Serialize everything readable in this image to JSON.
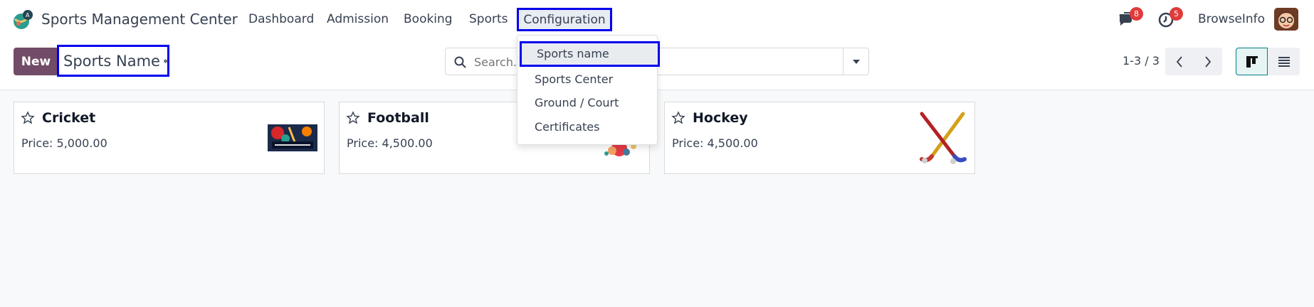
{
  "app": {
    "name": "Sports Management Center",
    "logo_icon": "sports-app-logo-icon"
  },
  "navbar": {
    "menu": [
      "Dashboard",
      "Admission",
      "Booking",
      "Sports"
    ],
    "active_menu": "Configuration",
    "messages_count": "8",
    "activities_count": "5",
    "company": "BrowseInfo"
  },
  "configuration_menu": {
    "items": [
      "Sports name",
      "Sports Center",
      "Ground / Court",
      "Certificates"
    ]
  },
  "control_panel": {
    "new_label": "New",
    "title": "Sports Name",
    "search_placeholder": "Search...",
    "pager": "1-3 / 3"
  },
  "cards": [
    {
      "title": "Cricket",
      "price": "Price: 5,000.00",
      "image": "cricket-image"
    },
    {
      "title": "Football",
      "price": "Price: 4,500.00",
      "image": "football-image"
    },
    {
      "title": "Hockey",
      "price": "Price: 4,500.00",
      "image": "hockey-sticks-image"
    }
  ],
  "colors": {
    "brand": "#714b67",
    "highlight_box": "#0000ee",
    "badge": "#e03b3b",
    "active_view": "#017e84"
  }
}
